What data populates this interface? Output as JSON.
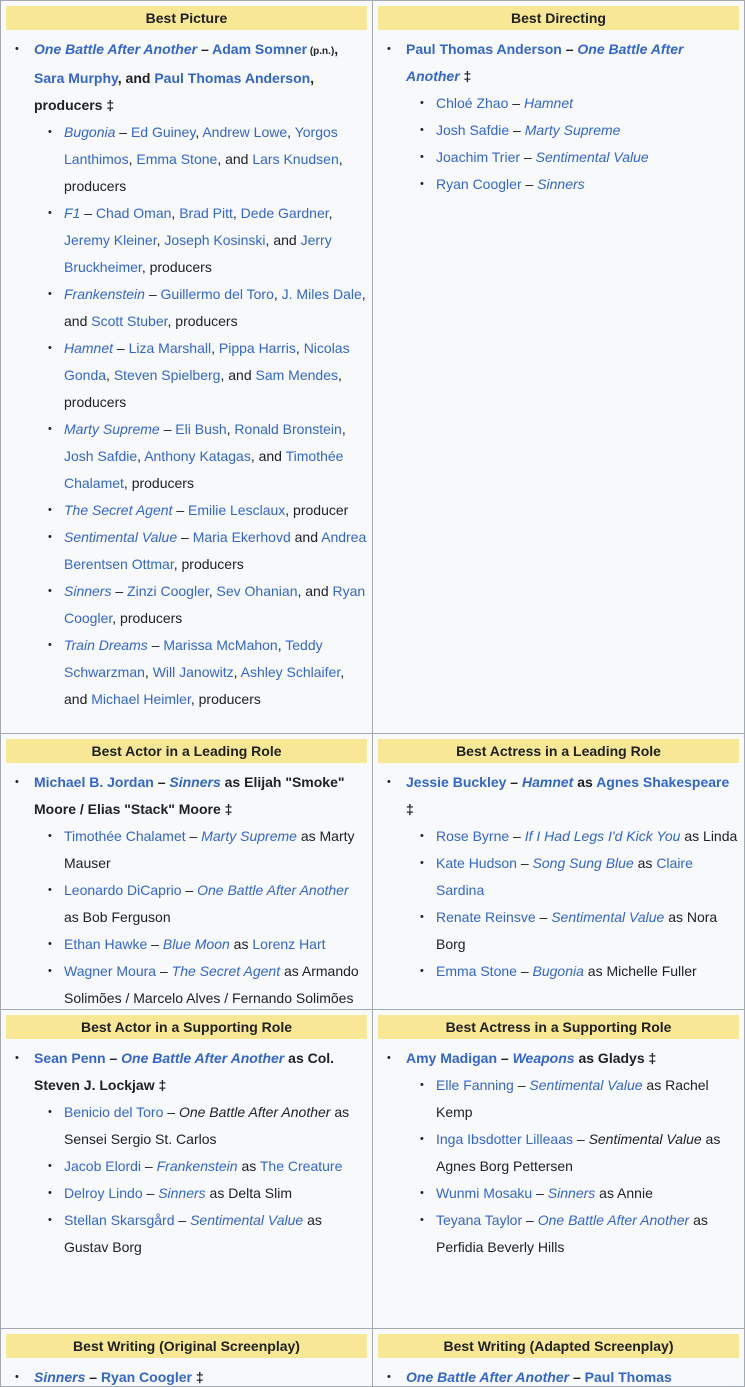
{
  "cells": [
    {
      "category": "Best Picture",
      "winner": [
        {
          "t": "One Battle After Another",
          "s": "film"
        },
        {
          "t": " – ",
          "s": "txt"
        },
        {
          "t": "Adam Somner",
          "s": "lnk"
        },
        {
          "t": " (p.n.)",
          "s": "pn"
        },
        {
          "t": ", ",
          "s": "txt"
        },
        {
          "t": "Sara Murphy",
          "s": "lnk"
        },
        {
          "t": ", and ",
          "s": "txt"
        },
        {
          "t": "Paul Thomas Anderson",
          "s": "lnk"
        },
        {
          "t": ", producers ‡",
          "s": "txt"
        }
      ],
      "nominees": [
        [
          {
            "t": "Bugonia",
            "s": "film"
          },
          {
            "t": " – ",
            "s": "txt"
          },
          {
            "t": "Ed Guiney",
            "s": "lnk"
          },
          {
            "t": ", ",
            "s": "txt"
          },
          {
            "t": "Andrew Lowe",
            "s": "lnk"
          },
          {
            "t": ", ",
            "s": "txt"
          },
          {
            "t": "Yorgos Lanthimos",
            "s": "lnk"
          },
          {
            "t": ", ",
            "s": "txt"
          },
          {
            "t": "Emma Stone",
            "s": "lnk"
          },
          {
            "t": ", and ",
            "s": "txt"
          },
          {
            "t": "Lars Knudsen",
            "s": "lnk"
          },
          {
            "t": ", producers",
            "s": "txt"
          }
        ],
        [
          {
            "t": "F1",
            "s": "film"
          },
          {
            "t": " – ",
            "s": "txt"
          },
          {
            "t": "Chad Oman",
            "s": "lnk"
          },
          {
            "t": ", ",
            "s": "txt"
          },
          {
            "t": "Brad Pitt",
            "s": "lnk"
          },
          {
            "t": ", ",
            "s": "txt"
          },
          {
            "t": "Dede Gardner",
            "s": "lnk"
          },
          {
            "t": ", ",
            "s": "txt"
          },
          {
            "t": "Jeremy Kleiner",
            "s": "lnk"
          },
          {
            "t": ", ",
            "s": "txt"
          },
          {
            "t": "Joseph Kosinski",
            "s": "lnk"
          },
          {
            "t": ", and ",
            "s": "txt"
          },
          {
            "t": "Jerry Bruckheimer",
            "s": "lnk"
          },
          {
            "t": ", producers",
            "s": "txt"
          }
        ],
        [
          {
            "t": "Frankenstein",
            "s": "film"
          },
          {
            "t": " – ",
            "s": "txt"
          },
          {
            "t": "Guillermo del Toro",
            "s": "lnk"
          },
          {
            "t": ", ",
            "s": "txt"
          },
          {
            "t": "J. Miles Dale",
            "s": "lnk"
          },
          {
            "t": ", and ",
            "s": "txt"
          },
          {
            "t": "Scott Stuber",
            "s": "lnk"
          },
          {
            "t": ", producers",
            "s": "txt"
          }
        ],
        [
          {
            "t": "Hamnet",
            "s": "film"
          },
          {
            "t": " – ",
            "s": "txt"
          },
          {
            "t": "Liza Marshall",
            "s": "lnk"
          },
          {
            "t": ", ",
            "s": "txt"
          },
          {
            "t": "Pippa Harris",
            "s": "lnk"
          },
          {
            "t": ", ",
            "s": "txt"
          },
          {
            "t": "Nicolas Gonda",
            "s": "lnk"
          },
          {
            "t": ", ",
            "s": "txt"
          },
          {
            "t": "Steven Spielberg",
            "s": "lnk"
          },
          {
            "t": ", and ",
            "s": "txt"
          },
          {
            "t": "Sam Mendes",
            "s": "lnk"
          },
          {
            "t": ", producers",
            "s": "txt"
          }
        ],
        [
          {
            "t": "Marty Supreme",
            "s": "film"
          },
          {
            "t": " – ",
            "s": "txt"
          },
          {
            "t": "Eli Bush",
            "s": "lnk"
          },
          {
            "t": ", ",
            "s": "txt"
          },
          {
            "t": "Ronald Bronstein",
            "s": "lnk"
          },
          {
            "t": ", ",
            "s": "txt"
          },
          {
            "t": "Josh Safdie",
            "s": "lnk"
          },
          {
            "t": ", ",
            "s": "txt"
          },
          {
            "t": "Anthony Katagas",
            "s": "lnk"
          },
          {
            "t": ", and ",
            "s": "txt"
          },
          {
            "t": "Timothée Chalamet",
            "s": "lnk"
          },
          {
            "t": ", producers",
            "s": "txt"
          }
        ],
        [
          {
            "t": "The Secret Agent",
            "s": "film"
          },
          {
            "t": " – ",
            "s": "txt"
          },
          {
            "t": "Emilie Lesclaux",
            "s": "lnk"
          },
          {
            "t": ", producer",
            "s": "txt"
          }
        ],
        [
          {
            "t": "Sentimental Value",
            "s": "film"
          },
          {
            "t": " – ",
            "s": "txt"
          },
          {
            "t": "Maria Ekerhovd",
            "s": "lnk"
          },
          {
            "t": " and ",
            "s": "txt"
          },
          {
            "t": "Andrea Berentsen Ottmar",
            "s": "lnk"
          },
          {
            "t": ", producers",
            "s": "txt"
          }
        ],
        [
          {
            "t": "Sinners",
            "s": "film"
          },
          {
            "t": " – ",
            "s": "txt"
          },
          {
            "t": "Zinzi Coogler",
            "s": "lnk"
          },
          {
            "t": ", ",
            "s": "txt"
          },
          {
            "t": "Sev Ohanian",
            "s": "lnk"
          },
          {
            "t": ", and ",
            "s": "txt"
          },
          {
            "t": "Ryan Coogler",
            "s": "lnk"
          },
          {
            "t": ", producers",
            "s": "txt"
          }
        ],
        [
          {
            "t": "Train Dreams",
            "s": "film"
          },
          {
            "t": " – ",
            "s": "txt"
          },
          {
            "t": "Marissa McMahon",
            "s": "lnk"
          },
          {
            "t": ", ",
            "s": "txt"
          },
          {
            "t": "Teddy Schwarzman",
            "s": "lnk"
          },
          {
            "t": ", ",
            "s": "txt"
          },
          {
            "t": "Will Janowitz",
            "s": "lnk"
          },
          {
            "t": ", ",
            "s": "txt"
          },
          {
            "t": "Ashley Schlaifer",
            "s": "lnk"
          },
          {
            "t": ", and ",
            "s": "txt"
          },
          {
            "t": "Michael Heimler",
            "s": "lnk"
          },
          {
            "t": ", producers",
            "s": "txt"
          }
        ]
      ]
    },
    {
      "category": "Best Directing",
      "winner": [
        {
          "t": "Paul Thomas Anderson",
          "s": "lnk"
        },
        {
          "t": " – ",
          "s": "txt"
        },
        {
          "t": "One Battle After Another",
          "s": "film"
        },
        {
          "t": " ‡",
          "s": "txt"
        }
      ],
      "nominees": [
        [
          {
            "t": "Chloé Zhao",
            "s": "lnk"
          },
          {
            "t": " – ",
            "s": "txt"
          },
          {
            "t": "Hamnet",
            "s": "film"
          }
        ],
        [
          {
            "t": "Josh Safdie",
            "s": "lnk"
          },
          {
            "t": " – ",
            "s": "txt"
          },
          {
            "t": "Marty Supreme",
            "s": "film"
          }
        ],
        [
          {
            "t": "Joachim Trier",
            "s": "lnk"
          },
          {
            "t": " – ",
            "s": "txt"
          },
          {
            "t": "Sentimental Value",
            "s": "film"
          }
        ],
        [
          {
            "t": "Ryan Coogler",
            "s": "lnk"
          },
          {
            "t": " – ",
            "s": "txt"
          },
          {
            "t": "Sinners",
            "s": "film"
          }
        ]
      ]
    },
    {
      "category": "Best Actor in a Leading Role",
      "winner": [
        {
          "t": "Michael B. Jordan",
          "s": "lnk"
        },
        {
          "t": " – ",
          "s": "txt"
        },
        {
          "t": "Sinners",
          "s": "film"
        },
        {
          "t": " as Elijah \"Smoke\" Moore / Elias \"Stack\" Moore ‡",
          "s": "txt"
        }
      ],
      "nominees": [
        [
          {
            "t": "Timothée Chalamet",
            "s": "lnk"
          },
          {
            "t": " – ",
            "s": "txt"
          },
          {
            "t": "Marty Supreme",
            "s": "film"
          },
          {
            "t": " as Marty Mauser",
            "s": "txt"
          }
        ],
        [
          {
            "t": "Leonardo DiCaprio",
            "s": "lnk"
          },
          {
            "t": " – ",
            "s": "txt"
          },
          {
            "t": "One Battle After Another",
            "s": "film"
          },
          {
            "t": " as Bob Ferguson",
            "s": "txt"
          }
        ],
        [
          {
            "t": "Ethan Hawke",
            "s": "lnk"
          },
          {
            "t": " – ",
            "s": "txt"
          },
          {
            "t": "Blue Moon",
            "s": "film"
          },
          {
            "t": " as ",
            "s": "txt"
          },
          {
            "t": "Lorenz Hart",
            "s": "lnk"
          }
        ],
        [
          {
            "t": "Wagner Moura",
            "s": "lnk"
          },
          {
            "t": " – ",
            "s": "txt"
          },
          {
            "t": "The Secret Agent",
            "s": "film"
          },
          {
            "t": " as Armando Solimões / Marcelo Alves / Fernando Solimões",
            "s": "txt"
          }
        ]
      ]
    },
    {
      "category": "Best Actress in a Leading Role",
      "winner": [
        {
          "t": "Jessie Buckley",
          "s": "lnk"
        },
        {
          "t": " – ",
          "s": "txt"
        },
        {
          "t": "Hamnet",
          "s": "film"
        },
        {
          "t": " as ",
          "s": "txt"
        },
        {
          "t": "Agnes Shakespeare",
          "s": "lnk"
        },
        {
          "t": " ‡",
          "s": "txt"
        }
      ],
      "nominees": [
        [
          {
            "t": "Rose Byrne",
            "s": "lnk"
          },
          {
            "t": " – ",
            "s": "txt"
          },
          {
            "t": "If I Had Legs I'd Kick You",
            "s": "film"
          },
          {
            "t": " as Linda",
            "s": "txt"
          }
        ],
        [
          {
            "t": "Kate Hudson",
            "s": "lnk"
          },
          {
            "t": " – ",
            "s": "txt"
          },
          {
            "t": "Song Sung Blue",
            "s": "film"
          },
          {
            "t": " as ",
            "s": "txt"
          },
          {
            "t": "Claire Sardina",
            "s": "lnk"
          }
        ],
        [
          {
            "t": "Renate Reinsve",
            "s": "lnk"
          },
          {
            "t": " – ",
            "s": "txt"
          },
          {
            "t": "Sentimental Value",
            "s": "film"
          },
          {
            "t": " as Nora Borg",
            "s": "txt"
          }
        ],
        [
          {
            "t": "Emma Stone",
            "s": "lnk"
          },
          {
            "t": " – ",
            "s": "txt"
          },
          {
            "t": "Bugonia",
            "s": "film"
          },
          {
            "t": " as Michelle Fuller",
            "s": "txt"
          }
        ]
      ]
    },
    {
      "category": "Best Actor in a Supporting Role",
      "winner": [
        {
          "t": "Sean Penn",
          "s": "lnk"
        },
        {
          "t": " – ",
          "s": "txt"
        },
        {
          "t": "One Battle After Another",
          "s": "film"
        },
        {
          "t": " as Col. Steven J. Lockjaw ‡",
          "s": "txt"
        }
      ],
      "nominees": [
        [
          {
            "t": "Benicio del Toro",
            "s": "lnk"
          },
          {
            "t": " – ",
            "s": "txt"
          },
          {
            "t": "One Battle After Another",
            "s": "filmp"
          },
          {
            "t": " as Sensei Sergio St. Carlos",
            "s": "txt"
          }
        ],
        [
          {
            "t": "Jacob Elordi",
            "s": "lnk"
          },
          {
            "t": " – ",
            "s": "txt"
          },
          {
            "t": "Frankenstein",
            "s": "film"
          },
          {
            "t": " as ",
            "s": "txt"
          },
          {
            "t": "The Creature",
            "s": "lnk"
          }
        ],
        [
          {
            "t": "Delroy Lindo",
            "s": "lnk"
          },
          {
            "t": " – ",
            "s": "txt"
          },
          {
            "t": "Sinners",
            "s": "film"
          },
          {
            "t": " as Delta Slim",
            "s": "txt"
          }
        ],
        [
          {
            "t": "Stellan Skarsgård",
            "s": "lnk"
          },
          {
            "t": " – ",
            "s": "txt"
          },
          {
            "t": "Sentimental Value",
            "s": "film"
          },
          {
            "t": " as Gustav Borg",
            "s": "txt"
          }
        ]
      ]
    },
    {
      "category": "Best Actress in a Supporting Role",
      "winner": [
        {
          "t": "Amy Madigan",
          "s": "lnk"
        },
        {
          "t": " – ",
          "s": "txt"
        },
        {
          "t": "Weapons",
          "s": "film"
        },
        {
          "t": " as Gladys ‡",
          "s": "txt"
        }
      ],
      "nominees": [
        [
          {
            "t": "Elle Fanning",
            "s": "lnk"
          },
          {
            "t": " – ",
            "s": "txt"
          },
          {
            "t": "Sentimental Value",
            "s": "film"
          },
          {
            "t": " as Rachel Kemp",
            "s": "txt"
          }
        ],
        [
          {
            "t": "Inga Ibsdotter Lilleaas",
            "s": "lnk"
          },
          {
            "t": " – ",
            "s": "txt"
          },
          {
            "t": "Sentimental Value",
            "s": "filmp"
          },
          {
            "t": " as Agnes Borg Pettersen",
            "s": "txt"
          }
        ],
        [
          {
            "t": "Wunmi Mosaku",
            "s": "lnk"
          },
          {
            "t": " – ",
            "s": "txt"
          },
          {
            "t": "Sinners",
            "s": "film"
          },
          {
            "t": " as Annie",
            "s": "txt"
          }
        ],
        [
          {
            "t": "Teyana Taylor",
            "s": "lnk"
          },
          {
            "t": " – ",
            "s": "txt"
          },
          {
            "t": "One Battle After Another",
            "s": "film"
          },
          {
            "t": " as Perfidia Beverly Hills",
            "s": "txt"
          }
        ]
      ]
    },
    {
      "category": "Best Writing (Original Screenplay)",
      "winner": [
        {
          "t": "Sinners",
          "s": "film"
        },
        {
          "t": " – ",
          "s": "txt"
        },
        {
          "t": "Ryan Coogler",
          "s": "lnk"
        },
        {
          "t": " ‡",
          "s": "txt"
        }
      ],
      "nominees": []
    },
    {
      "category": "Best Writing (Adapted Screenplay)",
      "winner": [
        {
          "t": "One Battle After Another",
          "s": "film"
        },
        {
          "t": " – ",
          "s": "txt"
        },
        {
          "t": "Paul Thomas Anderson",
          "s": "lnk"
        }
      ],
      "nominees": []
    }
  ]
}
